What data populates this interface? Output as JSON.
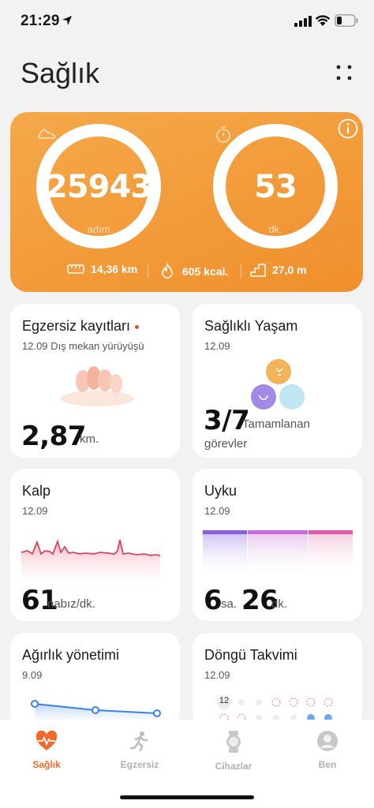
{
  "status": {
    "time": "21:29"
  },
  "header": {
    "title": "Sağlık"
  },
  "hero": {
    "steps": {
      "value": "25943",
      "unit": "adım"
    },
    "minutes": {
      "value": "53",
      "unit": "dk."
    },
    "distance": "14,36 km",
    "calories": "605 kcal.",
    "floors": "27,0 m",
    "colors": {
      "bg": "#f29a38",
      "ring": "#ffffff"
    }
  },
  "cards": {
    "exercise": {
      "title": "Egzersiz kayıtları",
      "sub": "12.09 Dış mekan yürüyüşü",
      "value": "2,87",
      "unit": "km."
    },
    "healthy": {
      "title": "Sağlıklı Yaşam",
      "sub": "12.09",
      "value": "3/7",
      "unit_line1": "Tamamlanan",
      "unit_line2": "görevler"
    },
    "heart": {
      "title": "Kalp",
      "sub": "12.09",
      "value": "61",
      "unit": "nabız/dk."
    },
    "sleep": {
      "title": "Uyku",
      "sub": "12.09",
      "hours": "6",
      "hours_unit": "sa.",
      "minutes": "26",
      "minutes_unit": "dk."
    },
    "weight": {
      "title": "Ağırlık yönetimi",
      "sub": "9.09"
    },
    "cycle": {
      "title": "Döngü Takvimi",
      "sub": "12.09",
      "day": "12"
    }
  },
  "tabs": [
    {
      "label": "Sağlık",
      "icon": "heart-pulse-icon",
      "active": true
    },
    {
      "label": "Egzersiz",
      "icon": "runner-icon",
      "active": false
    },
    {
      "label": "Cihazlar",
      "icon": "watch-icon",
      "active": false
    },
    {
      "label": "Ben",
      "icon": "profile-icon",
      "active": false
    }
  ]
}
